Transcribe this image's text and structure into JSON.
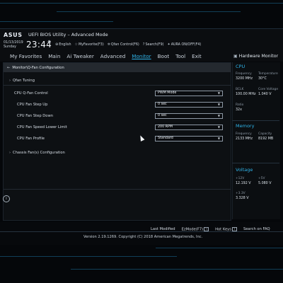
{
  "header": {
    "logo": "ASUS",
    "title": "UEFI BIOS Utility – Advanced Mode",
    "date": "01/13/2019",
    "day": "Sunday",
    "time": "23:44",
    "links": [
      {
        "icon": "globe-icon",
        "label": "English"
      },
      {
        "icon": "star-icon",
        "label": "MyFavorite(F3)"
      },
      {
        "icon": "fan-icon",
        "label": "Qfan Control(F6)"
      },
      {
        "icon": "search-icon",
        "label": "Search(F9)"
      },
      {
        "icon": "aura-icon",
        "label": "AURA ON/OFF(F4)"
      }
    ]
  },
  "menu": {
    "items": [
      "My Favorites",
      "Main",
      "Ai Tweaker",
      "Advanced",
      "Monitor",
      "Boot",
      "Tool",
      "Exit"
    ],
    "active": "Monitor",
    "hw_title": "Hardware Monitor"
  },
  "main": {
    "breadcrumb": "Monitor\\Q-Fan Configuration",
    "qfan_tuning": "Qfan Tuning",
    "settings": [
      {
        "label": "CPU Q-Fan Control",
        "value": "PWM Mode"
      },
      {
        "label": "CPU Fan Step Up",
        "value": "0 sec"
      },
      {
        "label": "CPU Fan Step Down",
        "value": "0 sec"
      },
      {
        "label": "CPU Fan Speed Lower Limit",
        "value": "200 RPM"
      },
      {
        "label": "CPU Fan Profile",
        "value": "Standard"
      }
    ],
    "chassis": "Chassis Fan(s) Configuration",
    "info_icon": "i"
  },
  "hw": {
    "cpu": {
      "title": "CPU",
      "frequency_label": "Frequency",
      "frequency": "3200 MHz",
      "temperature_label": "Temperature",
      "temperature": "30°C",
      "bclk_label": "BCLK",
      "bclk": "100.00 MHz",
      "core_voltage_label": "Core Voltage",
      "core_voltage": "1.040 V",
      "ratio_label": "Ratio",
      "ratio": "32x"
    },
    "memory": {
      "title": "Memory",
      "frequency_label": "Frequency",
      "frequency": "2133 MHz",
      "capacity_label": "Capacity",
      "capacity": "8192 MB"
    },
    "voltage": {
      "title": "Voltage",
      "v12_label": "+12V",
      "v12": "12.192 V",
      "v5_label": "+5V",
      "v5": "5.080 V",
      "v33_label": "+3.3V",
      "v33": "3.328 V"
    }
  },
  "footer": {
    "last_modified": "Last Modified",
    "ezmode": "EzMode(F7)",
    "hotkeys": "Hot Keys",
    "hotkeys_key": "?",
    "search_faq": "Search on FAQ",
    "version": "Version 2.19.1269. Copyright (C) 2018 American Megatrends, Inc."
  },
  "colors": {
    "accent": "#2fb3e8",
    "background": "#05070a",
    "panel": "#0d1013"
  }
}
